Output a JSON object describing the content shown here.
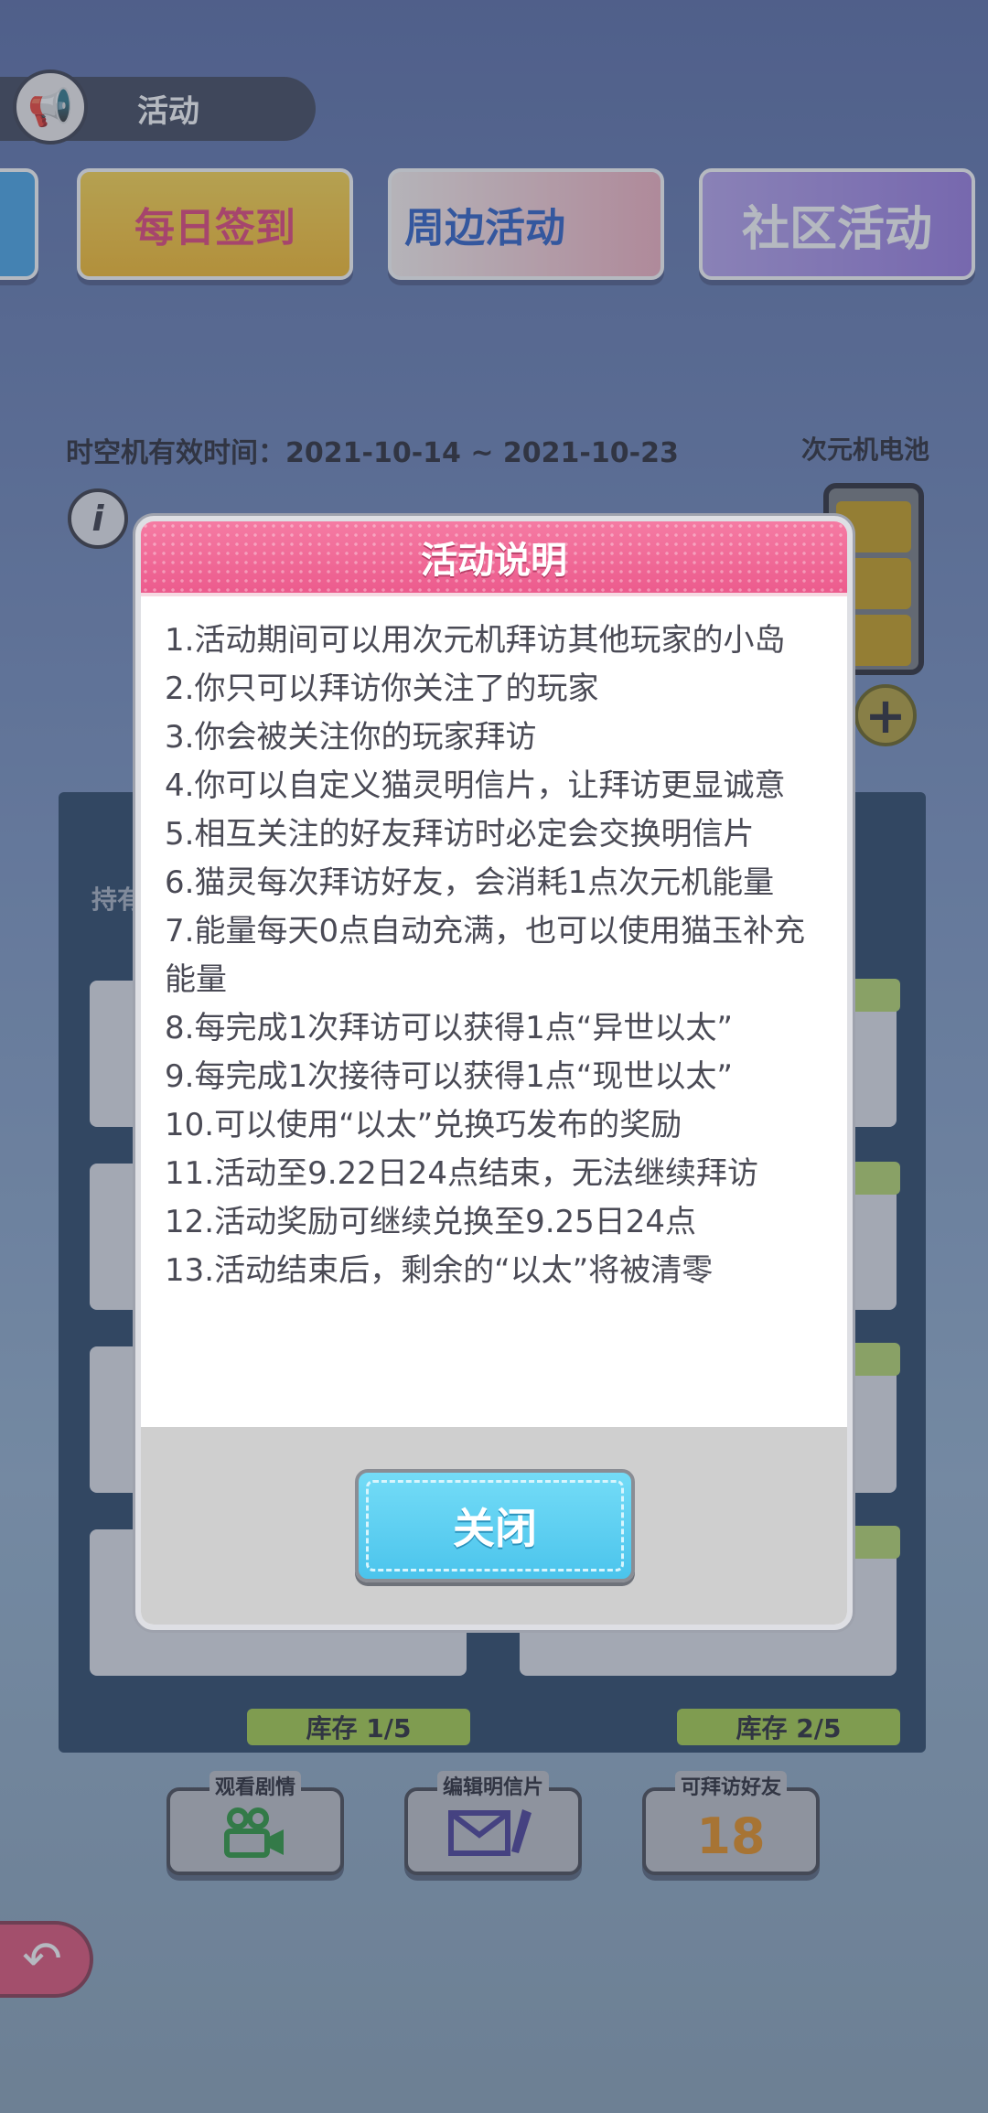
{
  "header": {
    "tab_title": "活动",
    "tab_icon": "megaphone-icon",
    "banners": [
      {
        "label": ""
      },
      {
        "label": "每日签到"
      },
      {
        "label": "周边活动"
      },
      {
        "label": "社区活动"
      }
    ]
  },
  "status": {
    "time_label": "时空机有效时间：2021-10-14 ~ 2021-10-23",
    "battery_label": "次元机电池"
  },
  "list": {
    "title_partial": "持有",
    "stock_items": [
      "库存 1/5",
      "库存 2/5"
    ]
  },
  "bottom_actions": [
    {
      "label": "观看剧情",
      "icon": "video-camera-icon",
      "color": "#2e9a3e"
    },
    {
      "label": "编辑明信片",
      "icon": "envelope-pen-icon",
      "color": "#4b3f9a"
    },
    {
      "label": "可拜访好友",
      "icon": "friend-count-icon",
      "glyph": "18",
      "color": "#e8901e"
    }
  ],
  "dialog": {
    "title": "活动说明",
    "rules": [
      "1.活动期间可以用次元机拜访其他玩家的小岛",
      "2.你只可以拜访你关注了的玩家",
      "3.你会被关注你的玩家拜访",
      "4.你可以自定义猫灵明信片，让拜访更显诚意",
      "5.相互关注的好友拜访时必定会交换明信片",
      "6.猫灵每次拜访好友，会消耗1点次元机能量",
      "7.能量每天0点自动充满，也可以使用猫玉补充能量",
      "8.每完成1次拜访可以获得1点“异世以太”",
      "9.每完成1次接待可以获得1点“现世以太”",
      "10.可以使用“以太”兑换巧发布的奖励",
      "11.活动至9.22日24点结束，无法继续拜访",
      "12.活动奖励可继续兑换至9.25日24点",
      "13.活动结束后，剩余的“以太”将被清零"
    ],
    "close_label": "关闭"
  },
  "colors": {
    "dialog_header": "#ec5b8d",
    "close_button": "#4bc4ec",
    "stock_bar": "#a8d14b"
  }
}
